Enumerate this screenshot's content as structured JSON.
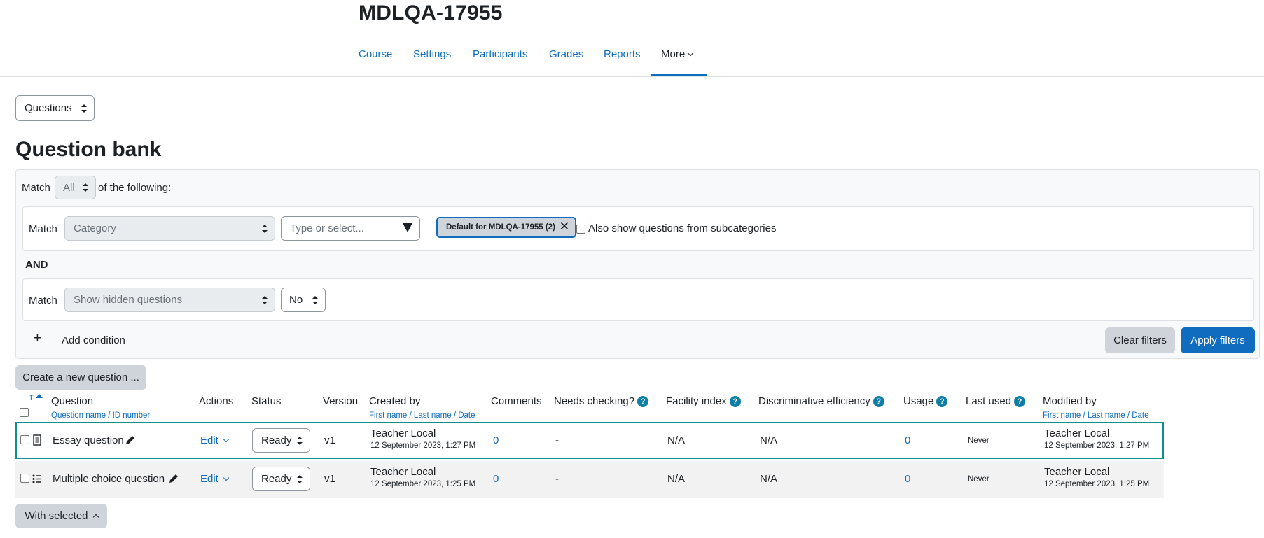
{
  "course": {
    "title": "MDLQA-17955"
  },
  "nav": {
    "items": [
      {
        "label": "Course"
      },
      {
        "label": "Settings"
      },
      {
        "label": "Participants"
      },
      {
        "label": "Grades"
      },
      {
        "label": "Reports"
      },
      {
        "label": "More"
      }
    ]
  },
  "page_select": {
    "value": "Questions"
  },
  "page": {
    "heading": "Question bank"
  },
  "filters": {
    "match_label": "Match",
    "match_value": "All",
    "of_following": "of the following:",
    "row1": {
      "match_label": "Match",
      "type_value": "Category",
      "search_placeholder": "Type or select...",
      "selected_pill": "Default for MDLQA-17955 (2)",
      "remove_symbol": "✕",
      "subcat_label": "Also show questions from subcategories"
    },
    "and_label": "AND",
    "row2": {
      "match_label": "Match",
      "type_value": "Show hidden questions",
      "value": "No"
    },
    "add_symbol": "+",
    "add_condition": "Add condition",
    "clear": "Clear filters",
    "apply": "Apply filters"
  },
  "create_button": "Create a new question ...",
  "table": {
    "sort_letter": "T",
    "headers": {
      "question": "Question",
      "question_sub_name": "Question name",
      "question_sub_sep": " / ",
      "question_sub_id": "ID number",
      "actions": "Actions",
      "status": "Status",
      "version": "Version",
      "created_by": "Created by",
      "created_sub_first": "First name",
      "created_sub_last": "Last name",
      "created_sub_date": "Date",
      "name_sep": " / ",
      "comments": "Comments",
      "needs_checking": "Needs checking?",
      "facility_index": "Facility index",
      "discriminative_efficiency": "Discriminative efficiency",
      "usage": "Usage",
      "last_used": "Last used",
      "modified_by": "Modified by",
      "modified_sub_first": "First name",
      "modified_sub_last": "Last name",
      "modified_sub_date": "Date",
      "help_symbol": "?"
    },
    "rows": [
      {
        "name": "Essay question",
        "action": "Edit",
        "status": "Ready",
        "version": "v1",
        "created_by": "Teacher Local",
        "created_date": "12 September 2023, 1:27 PM",
        "comments": "0",
        "needs_checking": "-",
        "facility_index": "N/A",
        "discriminative_efficiency": "N/A",
        "usage": "0",
        "last_used": "Never",
        "modified_by": "Teacher Local",
        "modified_date": "12 September 2023, 1:27 PM"
      },
      {
        "name": "Multiple choice question",
        "action": "Edit",
        "status": "Ready",
        "version": "v1",
        "created_by": "Teacher Local",
        "created_date": "12 September 2023, 1:25 PM",
        "comments": "0",
        "needs_checking": "-",
        "facility_index": "N/A",
        "discriminative_efficiency": "N/A",
        "usage": "0",
        "last_used": "Never",
        "modified_by": "Teacher Local",
        "modified_date": "12 September 2023, 1:25 PM"
      }
    ]
  },
  "with_selected": "With selected",
  "colors": {
    "accent": "#0f6cbf",
    "row_highlight": "#0f8f8a",
    "help": "#0f7ea6"
  }
}
